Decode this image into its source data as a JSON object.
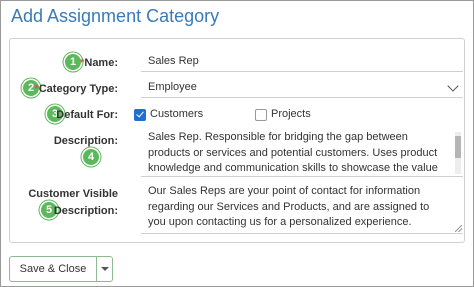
{
  "title": "Add Assignment Category",
  "colors": {
    "accent": "#3a7ab7",
    "badge": "#5cb85c",
    "required": "#d9534f",
    "check": "#1f6fd1"
  },
  "form": {
    "name": {
      "badge": "1",
      "required_mark": "*",
      "label": "Name:",
      "value": "Sales Rep"
    },
    "category_type": {
      "badge": "2",
      "required_mark": "*",
      "label": "Category Type:",
      "value": "Employee"
    },
    "default_for": {
      "badge": "3",
      "label": "Default For:",
      "options": [
        {
          "label": "Customers",
          "checked": true
        },
        {
          "label": "Projects",
          "checked": false
        }
      ]
    },
    "description": {
      "badge": "4",
      "label": "Description:",
      "value": "Sales Rep. Responsible for bridging the gap between products or services and potential customers. Uses product knowledge and communication skills to showcase the value of what they're selling."
    },
    "customer_visible_description": {
      "badge": "5",
      "label_line1": "Customer Visible",
      "label_line2": "Description:",
      "value": "Our Sales Reps are your point of contact for information regarding our Services and Products, and are assigned to you upon contacting us for a personalized experience."
    }
  },
  "footer": {
    "save_label": "Save & Close"
  }
}
